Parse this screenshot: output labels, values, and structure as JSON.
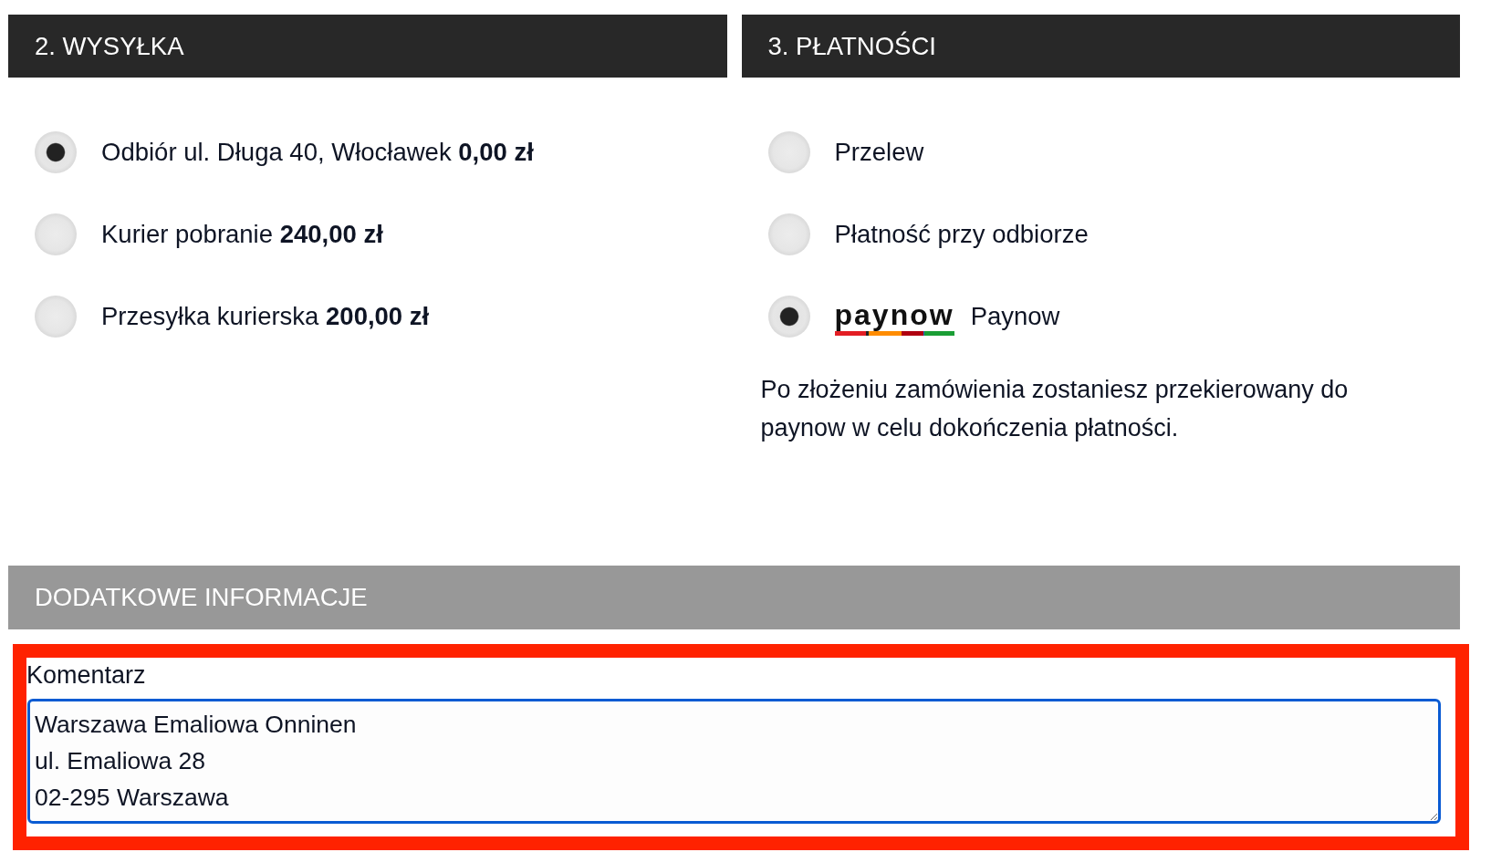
{
  "shipping": {
    "title": "2. WYSYŁKA",
    "options": [
      {
        "label": "Odbiór ul. Długa 40, Włocławek",
        "price": "0,00 zł",
        "selected": true
      },
      {
        "label": "Kurier pobranie",
        "price": "240,00 zł",
        "selected": false
      },
      {
        "label": "Przesyłka kurierska",
        "price": "200,00 zł",
        "selected": false
      }
    ]
  },
  "payment": {
    "title": "3. PŁATNOŚCI",
    "options": [
      {
        "kind": "plain",
        "label": "Przelew",
        "selected": false
      },
      {
        "kind": "plain",
        "label": "Płatność przy odbiorze",
        "selected": false
      },
      {
        "kind": "logo",
        "logo_text": "paynow",
        "label": "Paynow",
        "selected": true
      }
    ],
    "note": "Po złożeniu zamówienia zostaniesz przekierowany do paynow w celu dokończenia płatności."
  },
  "additional_info": {
    "title": "DODATKOWE INFORMACJE",
    "highlighted": true,
    "comment": {
      "label": "Komentarz",
      "value": "Warszawa Emaliowa Onninen\nul. Emaliowa 28\n02-295 Warszawa"
    }
  }
}
